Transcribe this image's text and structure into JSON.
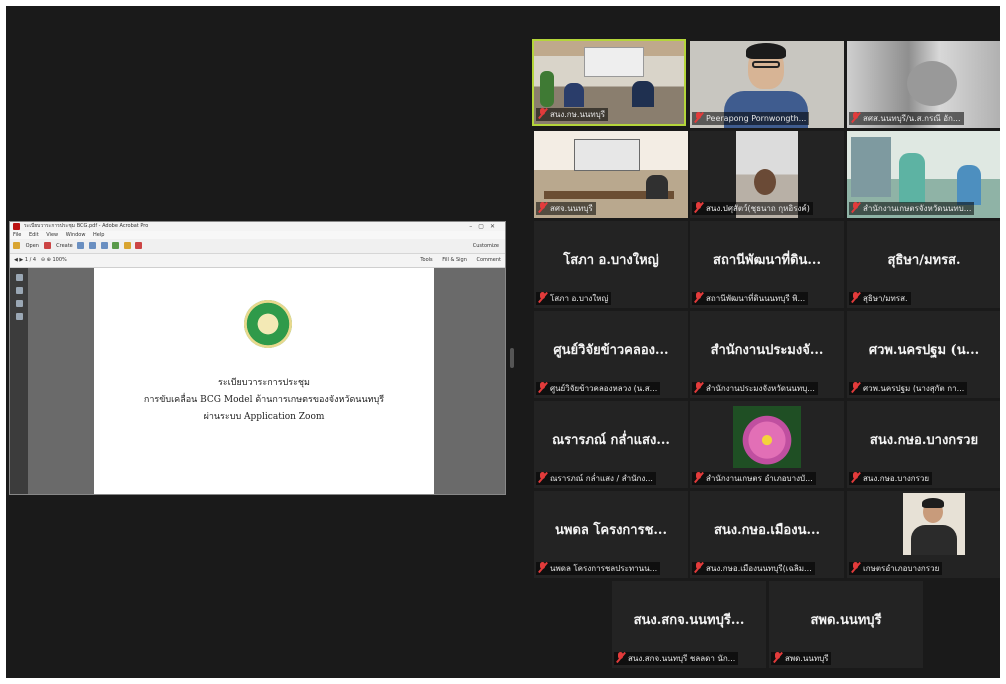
{
  "pdf_viewer": {
    "title": "ระเบียบวาระการประชุม BCG.pdf - Adobe Acrobat Pro",
    "menu": [
      "File",
      "Edit",
      "View",
      "Window",
      "Help"
    ],
    "open_label": "Open",
    "create_label": "Create",
    "customize_label": "Customize",
    "page_current": "1",
    "page_total": "/ 4",
    "zoom": "100%",
    "tools_label": "Tools",
    "fill_sign_label": "Fill & Sign",
    "comment_label": "Comment",
    "doc_line1": "ระเบียบวาระการประชุม",
    "doc_line2": "การขับเคลื่อน BCG Model ด้านการเกษตรของจังหวัดนนทบุรี",
    "doc_line3": "ผ่านระบบ Application Zoom"
  },
  "participants": [
    {
      "big": "",
      "caption": "สนง.กษ.นนทบุรี"
    },
    {
      "big": "",
      "caption": "Peerapong Pornwongth..."
    },
    {
      "big": "",
      "caption": "สศส.นนทบุรี/น.ส.กรณี อัก..."
    },
    {
      "big": "",
      "caption": "สศจ.นนทบุรี"
    },
    {
      "big": "",
      "caption": "สนง.ปศุสัตว์(ชุธนาถ กุหอิรงค์)"
    },
    {
      "big": "",
      "caption": "สำนักงานเกษตรจังหวัดนนทบ..."
    },
    {
      "big": "โสภา อ.บางใหญ่",
      "caption": "โสภา อ.บางใหญ่"
    },
    {
      "big": "สถานีพัฒนาที่ดิน...",
      "caption": "สถานีพัฒนาที่ดินนนทบุรี พิ..."
    },
    {
      "big": "สุธิษา/มทรส.",
      "caption": "สุธิษา/มทรส."
    },
    {
      "big": "ศูนย์วิจัยข้าวคลอง...",
      "caption": "ศูนย์วิจัยข้าวคลองหลวง (น.ส..."
    },
    {
      "big": "สำนักงานประมงจั...",
      "caption": "สำนักงานประมงจังหวัดนนทบุ..."
    },
    {
      "big": "ศวพ.นครปฐม (น...",
      "caption": "ศวพ.นครปฐม (นางสุกัต กา..."
    },
    {
      "big": "ณรารภณ์ กล่ำแสง...",
      "caption": "ณรารภณ์ กล่ำแสง / สำนักง..."
    },
    {
      "big": "",
      "caption": "สำนักงานเกษตร อำเภอบางบั..."
    },
    {
      "big": "สนง.กษอ.บางกรวย",
      "caption": "สนง.กษอ.บางกรวย"
    },
    {
      "big": "นพดล โครงการช...",
      "caption": "นพดล โครงการชลประทานน..."
    },
    {
      "big": "สนง.กษอ.เมืองน...",
      "caption": "สนง.กษอ.เมืองนนทบุรี(เฉลิม..."
    },
    {
      "big": "",
      "caption": "เกษตรอำเภอบางกรวย"
    },
    {
      "big": "สนง.สกจ.นนทบุรี...",
      "caption": "สนง.สกจ.นนทบุรี ชลลดา นัก..."
    },
    {
      "big": "สพด.นนทบุรี",
      "caption": "สพด.นนทบุรี"
    }
  ]
}
